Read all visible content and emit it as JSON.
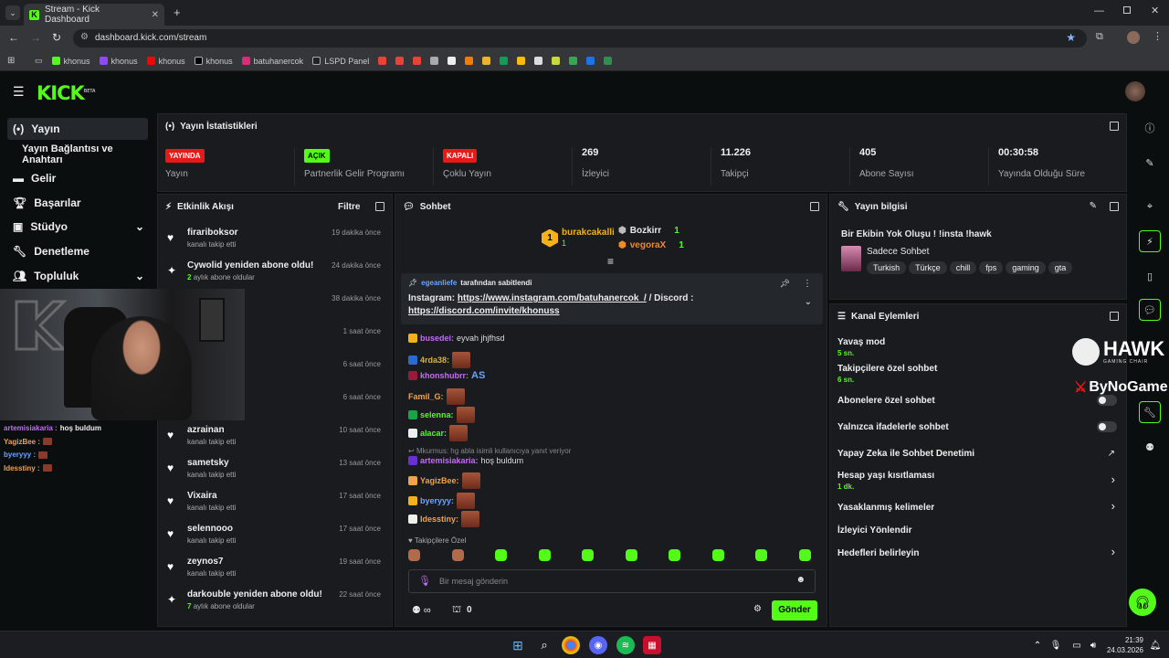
{
  "browser": {
    "tab_title": "Stream - Kick Dashboard",
    "url": "dashboard.kick.com/stream",
    "bookmarks": [
      "khonus",
      "khonus",
      "khonus",
      "khonus",
      "batuhanercok",
      "LSPD Panel"
    ]
  },
  "header": {
    "logo": "KICK",
    "logo_beta": "BETA"
  },
  "sidebar": {
    "items": [
      {
        "label": "Yayın"
      },
      {
        "label": "Yayın Bağlantısı ve Anahtarı"
      },
      {
        "label": "Gelir"
      },
      {
        "label": "Başarılar"
      },
      {
        "label": "Stüdyo"
      },
      {
        "label": "Denetleme"
      },
      {
        "label": "Topluluk"
      }
    ]
  },
  "stats": {
    "title": "Yayın İstatistikleri",
    "items": [
      {
        "badge": "YAYINDA",
        "badge_color": "#e91916",
        "label": "Yayın"
      },
      {
        "badge": "AÇIK",
        "badge_color": "#53fc18",
        "label": "Partnerlik Gelir Programı"
      },
      {
        "badge": "KAPALI",
        "badge_color": "#e91916",
        "label": "Çoklu Yayın"
      },
      {
        "value": "269",
        "label": "İzleyici"
      },
      {
        "value": "11.226",
        "label": "Takipçi"
      },
      {
        "value": "405",
        "label": "Abone Sayısı"
      },
      {
        "value": "00:30:58",
        "label": "Yayında Olduğu Süre"
      }
    ]
  },
  "activity": {
    "title": "Etkinlik Akışı",
    "filter": "Filtre",
    "items": [
      {
        "name": "firariboksor",
        "sub": "kanalı takip etti",
        "time": "19 dakika önce"
      },
      {
        "name": "Cywolid yeniden abone oldu!",
        "sub_num": "2",
        "sub": "aylık abone oldular",
        "time": "24 dakika önce"
      },
      {
        "name": "",
        "sub": "",
        "time": "38 dakika önce"
      },
      {
        "name": "",
        "sub": "",
        "time": "1 saat önce"
      },
      {
        "name": "",
        "sub": "",
        "time": "6 saat önce"
      },
      {
        "name": "",
        "sub": "",
        "time": "6 saat önce"
      },
      {
        "name": "azrainan",
        "sub": "kanalı takip etti",
        "time": "10 saat önce"
      },
      {
        "name": "sametsky",
        "sub": "kanalı takip etti",
        "time": "13 saat önce"
      },
      {
        "name": "Vixaira",
        "sub": "kanalı takip etti",
        "time": "17 saat önce"
      },
      {
        "name": "selennooo",
        "sub": "kanalı takip etti",
        "time": "17 saat önce"
      },
      {
        "name": "zeynos7",
        "sub": "kanalı takip etti",
        "time": "19 saat önce"
      },
      {
        "name": "darkouble yeniden abone oldu!",
        "sub_num": "7",
        "sub": "aylık abone oldular",
        "time": "22 saat önce"
      }
    ]
  },
  "chat": {
    "title": "Sohbet",
    "top_gifters": [
      {
        "name": "burakcakalli",
        "count": "1"
      },
      {
        "name": "Bozkirr",
        "count": "1"
      },
      {
        "name": "vegoraX",
        "count": "1"
      }
    ],
    "pinned_by": "egeanliefe",
    "pinned_by_suffix": "tarafından sabitlendi",
    "pinned_text": "Instagram:",
    "pinned_link1": "https://www.instagram.com/batuhanercok_/",
    "pinned_mid": "Discord :",
    "pinned_link2": "https://discord.com/invite/khonuss",
    "messages": [
      {
        "user": "busedei:",
        "text": "eyvah jhjfhsd",
        "color": "#c46cf5"
      },
      {
        "user": "4rda38:",
        "text": "",
        "color": "#d5b14a"
      },
      {
        "user": "khonshubrr:",
        "text": "AS",
        "color": "#c46cf5"
      },
      {
        "user": "Famil_G:",
        "text": "",
        "color": "#f0a24c"
      },
      {
        "user": "selenna:",
        "text": "",
        "color": "#53fc18"
      },
      {
        "user": "alacar:",
        "text": "",
        "color": "#53fc18"
      },
      {
        "user": "artemisiakaria:",
        "text": "hoş buldum",
        "color": "#c46cf5"
      },
      {
        "user": "YagizBee:",
        "text": "",
        "color": "#f0a24c"
      },
      {
        "user": "byeryyy:",
        "text": "",
        "color": "#6ba3ff"
      },
      {
        "user": "Idesstiny:",
        "text": "",
        "color": "#f0a24c"
      }
    ],
    "reply_line": "Mkurmus: hg abla isimli kullanıcıya yanıt veriyor",
    "followers_only": "Takipçilere Özel",
    "input_placeholder": "Bir mesaj gönderin",
    "points": "0",
    "send": "Gönder"
  },
  "stream_info": {
    "title": "Yayın bilgisi",
    "stream_title": "Bir Ekibin Yok Oluşu ! !insta !hawk",
    "category": "Sadece Sohbet",
    "tags": [
      "Turkish",
      "Türkçe",
      "chill",
      "fps",
      "gaming",
      "gta"
    ]
  },
  "channel_actions": {
    "title": "Kanal Eylemleri",
    "items": [
      {
        "label": "Yavaş mod",
        "sub": "5 sn."
      },
      {
        "label": "Takipçilere özel sohbet",
        "sub": "6 sn."
      },
      {
        "label": "Abonelere özel sohbet",
        "sub": ""
      },
      {
        "label": "Yalnızca ifadelerle sohbet",
        "sub": ""
      },
      {
        "label": "Yapay Zeka ile Sohbet Denetimi",
        "sub": ""
      },
      {
        "label": "Hesap yaşı kısıtlaması",
        "sub": "1 dk."
      },
      {
        "label": "Yasaklanmış kelimeler",
        "sub": ""
      },
      {
        "label": "İzleyici Yönlendir",
        "sub": ""
      },
      {
        "label": "Hedefleri belirleyin",
        "sub": ""
      }
    ]
  },
  "overlay": {
    "hawk": "HAWK",
    "hawk_sub": "GAMING CHAIR",
    "bynogame": "ByNoGame"
  },
  "webcam_chat": [
    {
      "user": "artemisiakaria :",
      "text": "hoş buldum",
      "color": "#c46cf5"
    },
    {
      "user": "YagizBee :",
      "text": "",
      "color": "#f0a24c"
    },
    {
      "user": "byeryyy :",
      "text": "",
      "color": "#6ba3ff"
    },
    {
      "user": "Idesstiny :",
      "text": "",
      "color": "#f0a24c"
    }
  ],
  "taskbar": {
    "time": "21:39",
    "date": "24.03.2026"
  }
}
